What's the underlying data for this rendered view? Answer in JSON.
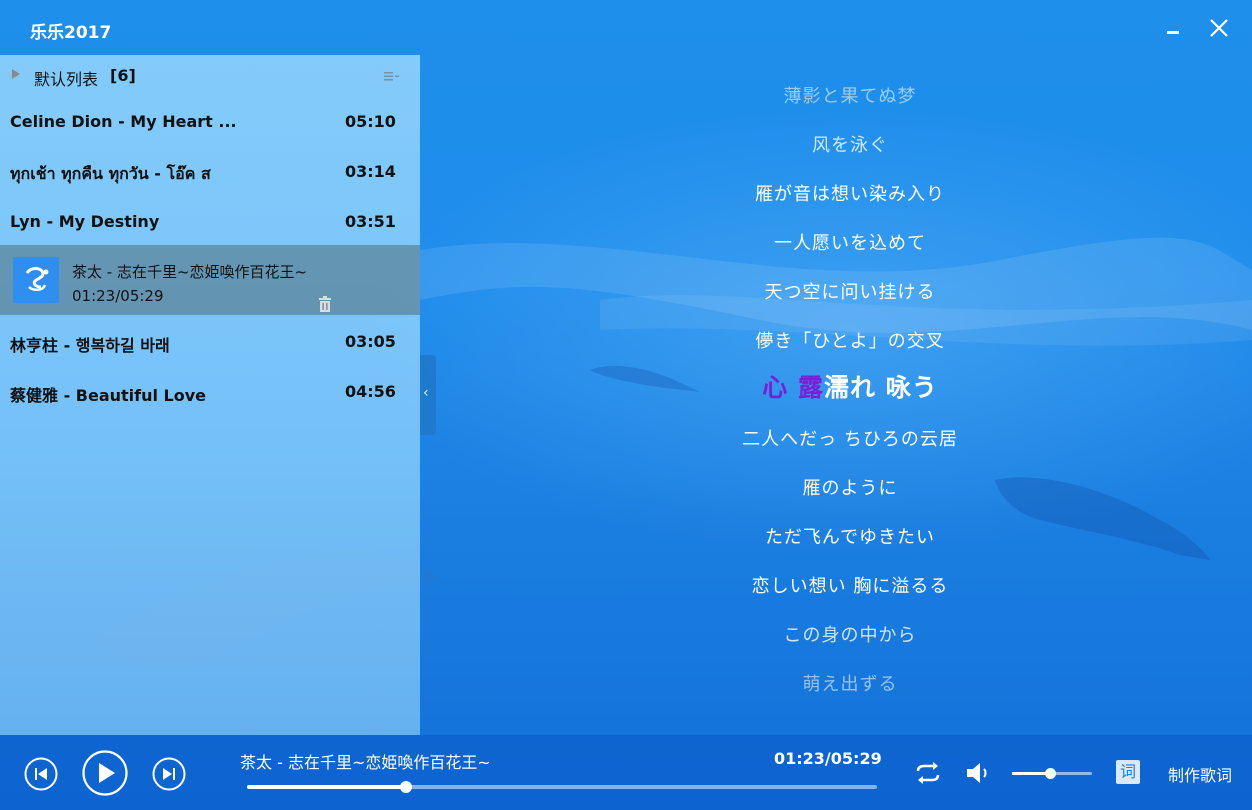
{
  "app": {
    "title": "乐乐2017"
  },
  "window": {
    "minimize_icon": "minimize-icon",
    "close_icon": "close-icon"
  },
  "playlist": {
    "name": "默认列表",
    "count": "[6]",
    "tracks": [
      {
        "title": "Celine Dion - My Heart ...",
        "duration": "05:10"
      },
      {
        "title": "ทุกเช้า ทุกคืน ทุกวัน - โอ๊ค ส",
        "duration": "03:14"
      },
      {
        "title": "Lyn - My Destiny",
        "duration": "03:51"
      },
      {
        "title": "茶太 - 志在千里~恋姫喚作百花王~",
        "progress": "01:23/05:29"
      },
      {
        "title": "林亨柱 - 행복하길 바래",
        "duration": "03:05"
      },
      {
        "title": "蔡健雅 - Beautiful Love",
        "duration": "04:56"
      }
    ]
  },
  "lyrics": {
    "lines": [
      "薄影と果てぬ梦",
      "风を泳ぐ",
      "雁が音は想い染み入り",
      "一人愿いを込めて",
      "天つ空に问い挂ける",
      "儚き「ひとよ」の交叉",
      "二人へだっ ちひろの云居",
      "雁のように",
      "ただ飞んでゆきたい",
      "恋しい想い 胸に溢るる",
      "この身の中から",
      "萌え出ずる"
    ],
    "current_sung": "心 露",
    "current_rest": "濡れ 咏う"
  },
  "player": {
    "now_playing": "茶太 - 志在千里~恋姫喚作百花王~",
    "time": "01:23/05:29",
    "progress_fraction": 0.252,
    "volume_fraction": 0.48,
    "lyric_toggle_label": "词",
    "make_lyrics_label": "制作歌词"
  },
  "colors": {
    "accent": "#1f8cec",
    "sung_lyric": "#7a1fd6"
  }
}
